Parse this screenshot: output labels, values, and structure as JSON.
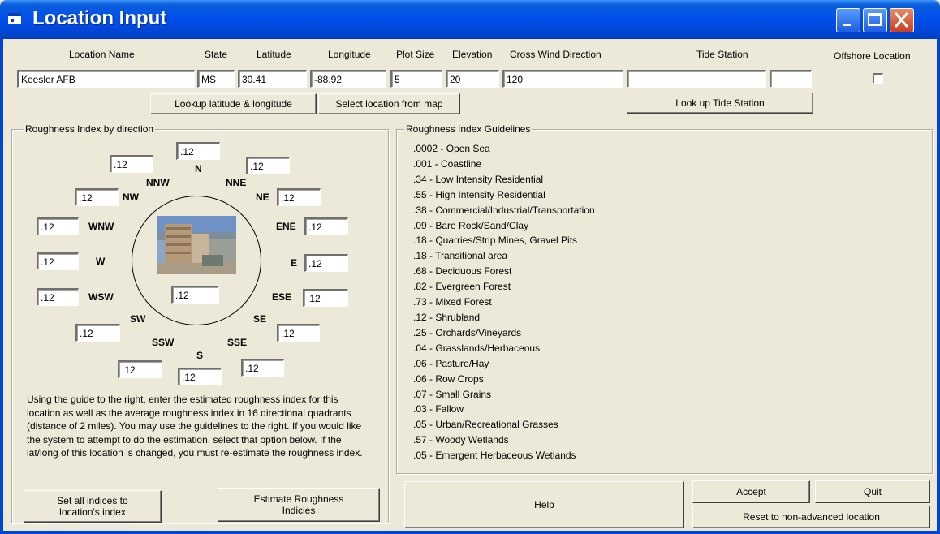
{
  "window": {
    "title": "Location Input",
    "colors": {
      "titlebar": "#0046d5",
      "face": "#ece9d8",
      "close": "#c84020"
    }
  },
  "header": {
    "location_name_label": "Location Name",
    "state_label": "State",
    "latitude_label": "Latitude",
    "longitude_label": "Longitude",
    "plot_size_label": "Plot Size",
    "elevation_label": "Elevation",
    "cross_wind_label": "Cross Wind Direction",
    "tide_station_label": "Tide Station",
    "offshore_label": "Offshore Location"
  },
  "fields": {
    "location_name": "Keesler AFB",
    "state": "MS",
    "latitude": "30.41",
    "longitude": "-88.92",
    "plot_size": "5",
    "elevation": "20",
    "cross_wind": "120",
    "tide_station": "",
    "tide_station_id": "",
    "offshore_checked": false
  },
  "buttons": {
    "lookup_latlong": "Lookup latitude & longitude",
    "select_map": "Select location from map",
    "lookup_tide": "Look up Tide Station",
    "set_all_line1": "Set all indices to",
    "set_all_line2": "location's index",
    "estimate_line1": "Estimate Roughness",
    "estimate_line2": "Indicies",
    "help": "Help",
    "accept": "Accept",
    "quit": "Quit",
    "reset": "Reset to non-advanced location"
  },
  "roughness": {
    "group_title": "Roughness Index by direction",
    "center": ".12",
    "directions": {
      "N": {
        "label": "N",
        "value": ".12"
      },
      "NNE": {
        "label": "NNE",
        "value": ".12"
      },
      "NE": {
        "label": "NE",
        "value": ".12"
      },
      "ENE": {
        "label": "ENE",
        "value": ".12"
      },
      "E": {
        "label": "E",
        "value": ".12"
      },
      "ESE": {
        "label": "ESE",
        "value": ".12"
      },
      "SE": {
        "label": "SE",
        "value": ".12"
      },
      "SSE": {
        "label": "SSE",
        "value": ".12"
      },
      "S": {
        "label": "S",
        "value": ".12"
      },
      "SSW": {
        "label": "SSW",
        "value": ".12"
      },
      "SW": {
        "label": "SW",
        "value": ".12"
      },
      "WSW": {
        "label": "WSW",
        "value": ".12"
      },
      "W": {
        "label": "W",
        "value": ".12"
      },
      "WNW": {
        "label": "WNW",
        "value": ".12"
      },
      "NW": {
        "label": "NW",
        "value": ".12"
      },
      "NNW": {
        "label": "NNW",
        "value": ".12"
      }
    },
    "instructions": "Using the guide to the right, enter the estimated roughness index for this location as well as the average roughness index in 16 directional quadrants (distance of 2 miles).  You may use the guidelines to the right.  If you would like the system to attempt to do the estimation, select that option below.  If the lat/long of this location is changed, you must re-estimate the roughness index."
  },
  "guidelines": {
    "group_title": "Roughness Index Guidelines",
    "items": [
      ".0002 - Open Sea",
      ".001  - Coastline",
      ".34   - Low Intensity Residential",
      ".55   - High Intensity Residential",
      ".38   - Commercial/Industrial/Transportation",
      ".09   - Bare Rock/Sand/Clay",
      ".18   - Quarries/Strip Mines, Gravel Pits",
      ".18   - Transitional area",
      ".68   - Deciduous Forest",
      ".82   - Evergreen Forest",
      ".73   - Mixed Forest",
      ".12   - Shrubland",
      ".25   - Orchards/Vineyards",
      ".04   - Grasslands/Herbaceous",
      ".06   - Pasture/Hay",
      ".06   - Row Crops",
      ".07   - Small Grains",
      ".03   - Fallow",
      ".05   - Urban/Recreational Grasses",
      ".57   - Woody Wetlands",
      ".05   - Emergent Herbaceous Wetlands"
    ]
  }
}
